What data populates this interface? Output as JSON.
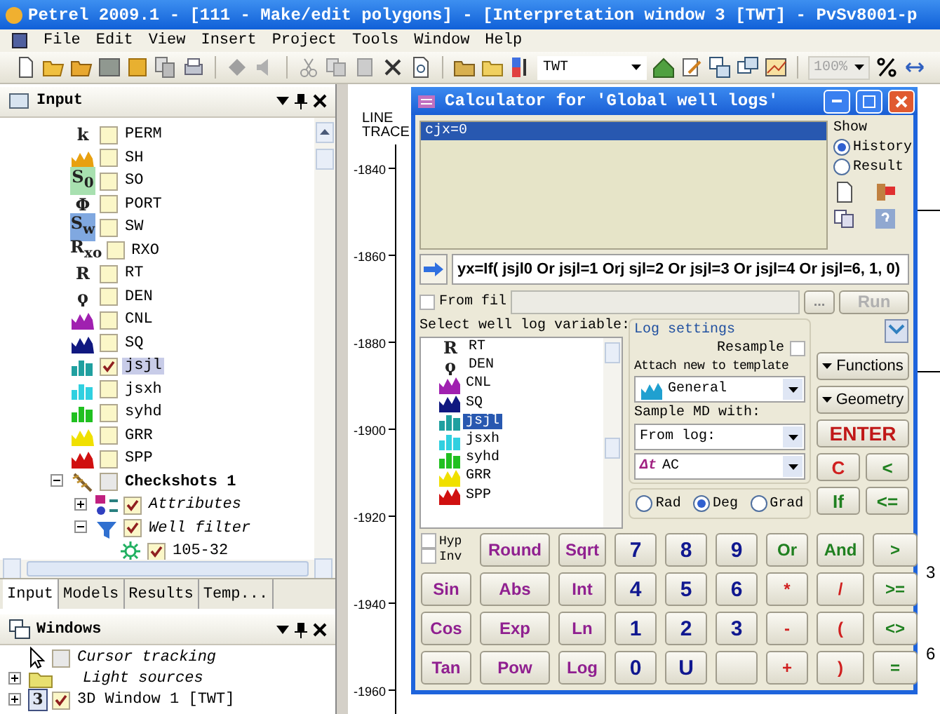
{
  "window": {
    "title": "Petrel 2009.1 - [111 - Make/edit polygons] - [Interpretation window 3 [TWT] - PvSv8001-p"
  },
  "menu": [
    "File",
    "Edit",
    "View",
    "Insert",
    "Project",
    "Tools",
    "Window",
    "Help"
  ],
  "toolbar": {
    "domain": "TWT",
    "zoom": "100%"
  },
  "input_panel": {
    "title": "Input",
    "tree": [
      {
        "label": "PERM",
        "kind": "glyph",
        "glyph": "k",
        "checked": false,
        "selected": false
      },
      {
        "label": "SH",
        "kind": "mountain",
        "color": "#e8a010",
        "checked": false,
        "selected": false
      },
      {
        "label": "SO",
        "kind": "glyph",
        "glyph": "S$_{0}$",
        "color": "#a8e0b0",
        "checked": false,
        "selected": false
      },
      {
        "label": "PORT",
        "kind": "glyph",
        "glyph": "Φ",
        "checked": false,
        "selected": false
      },
      {
        "label": "SW",
        "kind": "glyph",
        "glyph": "S$_{w}$",
        "color": "#80a8e0",
        "checked": false,
        "selected": false
      },
      {
        "label": "RXO",
        "kind": "glyph",
        "glyph": "R$_{xo}$",
        "checked": false,
        "selected": false
      },
      {
        "label": "RT",
        "kind": "glyph",
        "glyph": "R",
        "checked": false,
        "selected": false
      },
      {
        "label": "DEN",
        "kind": "glyph",
        "glyph": "ϙ",
        "checked": false,
        "selected": false
      },
      {
        "label": "CNL",
        "kind": "mountain",
        "color": "#a020b0",
        "checked": false,
        "selected": false
      },
      {
        "label": "SQ",
        "kind": "mountain",
        "color": "#101880",
        "checked": false,
        "selected": false
      },
      {
        "label": "jsjl",
        "kind": "bars",
        "color": "#20a0a0",
        "checked": true,
        "selected": true
      },
      {
        "label": "jsxh",
        "kind": "bars",
        "color": "#30d0e0",
        "checked": false,
        "selected": false
      },
      {
        "label": "syhd",
        "kind": "bars",
        "color": "#20c020",
        "checked": false,
        "selected": false
      },
      {
        "label": "GRR",
        "kind": "mountain",
        "color": "#f0e000",
        "checked": false,
        "selected": false
      },
      {
        "label": "SPP",
        "kind": "mountain",
        "color": "#d01010",
        "checked": false,
        "selected": false
      },
      {
        "label": "Checkshots 1",
        "kind": "checkshots",
        "checked": false,
        "selected": false,
        "expanded": true,
        "children": [
          {
            "label": "Attributes",
            "kind": "attributes",
            "checked": true,
            "selected": false,
            "expanded": false
          },
          {
            "label": "Well filter",
            "kind": "filter",
            "checked": true,
            "selected": false,
            "expanded": true,
            "children": [
              {
                "label": "105-32",
                "kind": "well",
                "checked": true,
                "selected": false
              }
            ]
          }
        ]
      }
    ]
  },
  "panel_tabs": [
    {
      "label": "Input",
      "selected": true
    },
    {
      "label": "Models",
      "selected": false
    },
    {
      "label": "Results",
      "selected": false
    },
    {
      "label": "Temp...",
      "selected": false
    }
  ],
  "windows_panel": {
    "title": "Windows",
    "items": [
      {
        "label": "Cursor tracking",
        "kind": "cursor",
        "checked": false
      },
      {
        "label": "Light sources",
        "kind": "folder",
        "expanded": false
      },
      {
        "label": "3D Window 1 [TWT]",
        "kind": "window",
        "badge": "3",
        "checked": true,
        "expanded": false
      }
    ]
  },
  "plot": {
    "header": "LINE TRACE",
    "depth_labels": [
      "-1840",
      "-1860",
      "-1880",
      "-1900",
      "-1920",
      "-1940",
      "-1960"
    ],
    "side_labels": [
      "3",
      "6"
    ]
  },
  "calculator": {
    "title": "Calculator for 'Global well logs'",
    "history": [
      {
        "text": "cjx=0",
        "selected": true
      }
    ],
    "show_label": "Show",
    "show_options": [
      {
        "label": "History",
        "selected": true
      },
      {
        "label": "Result",
        "selected": false
      }
    ],
    "expression": "yx=If( jsjl0 Or jsjl=1 Orj sjl=2 Or jsjl=3 Or jsjl=4 Or jsjl=6, 1, 0)",
    "from_file": {
      "label": "From fil",
      "checked": false,
      "browse": "...",
      "run": "Run",
      "run_disabled": true
    },
    "variable_label": "Select well log variable:",
    "variables": [
      {
        "label": "RT",
        "kind": "glyph",
        "glyph": "R",
        "selected": false
      },
      {
        "label": "DEN",
        "kind": "glyph",
        "glyph": "ϙ",
        "selected": false
      },
      {
        "label": "CNL",
        "kind": "mountain",
        "color": "#a020b0",
        "selected": false
      },
      {
        "label": "SQ",
        "kind": "mountain",
        "color": "#101880",
        "selected": false
      },
      {
        "label": "jsjl",
        "kind": "bars",
        "color": "#20a0a0",
        "selected": true
      },
      {
        "label": "jsxh",
        "kind": "bars",
        "color": "#30d0e0",
        "selected": false
      },
      {
        "label": "syhd",
        "kind": "bars",
        "color": "#20c020",
        "selected": false
      },
      {
        "label": "GRR",
        "kind": "mountain",
        "color": "#f0e000",
        "selected": false
      },
      {
        "label": "SPP",
        "kind": "mountain",
        "color": "#d01010",
        "selected": false
      }
    ],
    "log_settings": {
      "title": "Log settings",
      "resample": {
        "label": "Resample",
        "checked": false
      },
      "attach_label": "Attach new to template",
      "template": "General",
      "sample_label": "Sample MD with:",
      "sample_source": "From log:",
      "sample_log": {
        "glyph": "Δt",
        "label": "AC"
      }
    },
    "angle_units": [
      {
        "label": "Rad",
        "selected": false
      },
      {
        "label": "Deg",
        "selected": true
      },
      {
        "label": "Grad",
        "selected": false
      }
    ],
    "side_buttons": [
      {
        "label": "Functions",
        "kind": "menu"
      },
      {
        "label": "Geometry",
        "kind": "menu"
      },
      {
        "label": "ENTER",
        "kind": "enter"
      },
      {
        "label": "C",
        "kind": "op"
      },
      {
        "label": "<",
        "kind": "cmp"
      },
      {
        "label": "If",
        "kind": "logic"
      },
      {
        "label": "<=",
        "kind": "cmp"
      }
    ],
    "modifiers": [
      {
        "label": "Hyp",
        "checked": false
      },
      {
        "label": "Inv",
        "checked": false
      }
    ],
    "keys": [
      {
        "label": "Round",
        "kind": "func"
      },
      {
        "label": "Sqrt",
        "kind": "func"
      },
      {
        "label": "7",
        "kind": "digit"
      },
      {
        "label": "8",
        "kind": "digit"
      },
      {
        "label": "9",
        "kind": "digit"
      },
      {
        "label": "Or",
        "kind": "logic"
      },
      {
        "label": "And",
        "kind": "logic"
      },
      {
        "label": ">",
        "kind": "cmp"
      },
      {
        "label": "Sin",
        "kind": "func"
      },
      {
        "label": "Abs",
        "kind": "func"
      },
      {
        "label": "Int",
        "kind": "func"
      },
      {
        "label": "4",
        "kind": "digit"
      },
      {
        "label": "5",
        "kind": "digit"
      },
      {
        "label": "6",
        "kind": "digit"
      },
      {
        "label": "*",
        "kind": "op"
      },
      {
        "label": "/",
        "kind": "op"
      },
      {
        "label": ">=",
        "kind": "cmp"
      },
      {
        "label": "Cos",
        "kind": "func"
      },
      {
        "label": "Exp",
        "kind": "func"
      },
      {
        "label": "Ln",
        "kind": "func"
      },
      {
        "label": "1",
        "kind": "digit"
      },
      {
        "label": "2",
        "kind": "digit"
      },
      {
        "label": "3",
        "kind": "digit"
      },
      {
        "label": "-",
        "kind": "op"
      },
      {
        "label": "(",
        "kind": "op"
      },
      {
        "label": "<>",
        "kind": "cmp"
      },
      {
        "label": "Tan",
        "kind": "func"
      },
      {
        "label": "Pow",
        "kind": "func"
      },
      {
        "label": "Log",
        "kind": "func"
      },
      {
        "label": "0",
        "kind": "digit"
      },
      {
        "label": "U",
        "kind": "digit"
      },
      {
        "kind": "op"
      },
      {
        "label": "+",
        "kind": "op"
      },
      {
        "label": ")",
        "kind": "op"
      },
      {
        "label": "=",
        "kind": "cmp"
      }
    ]
  }
}
